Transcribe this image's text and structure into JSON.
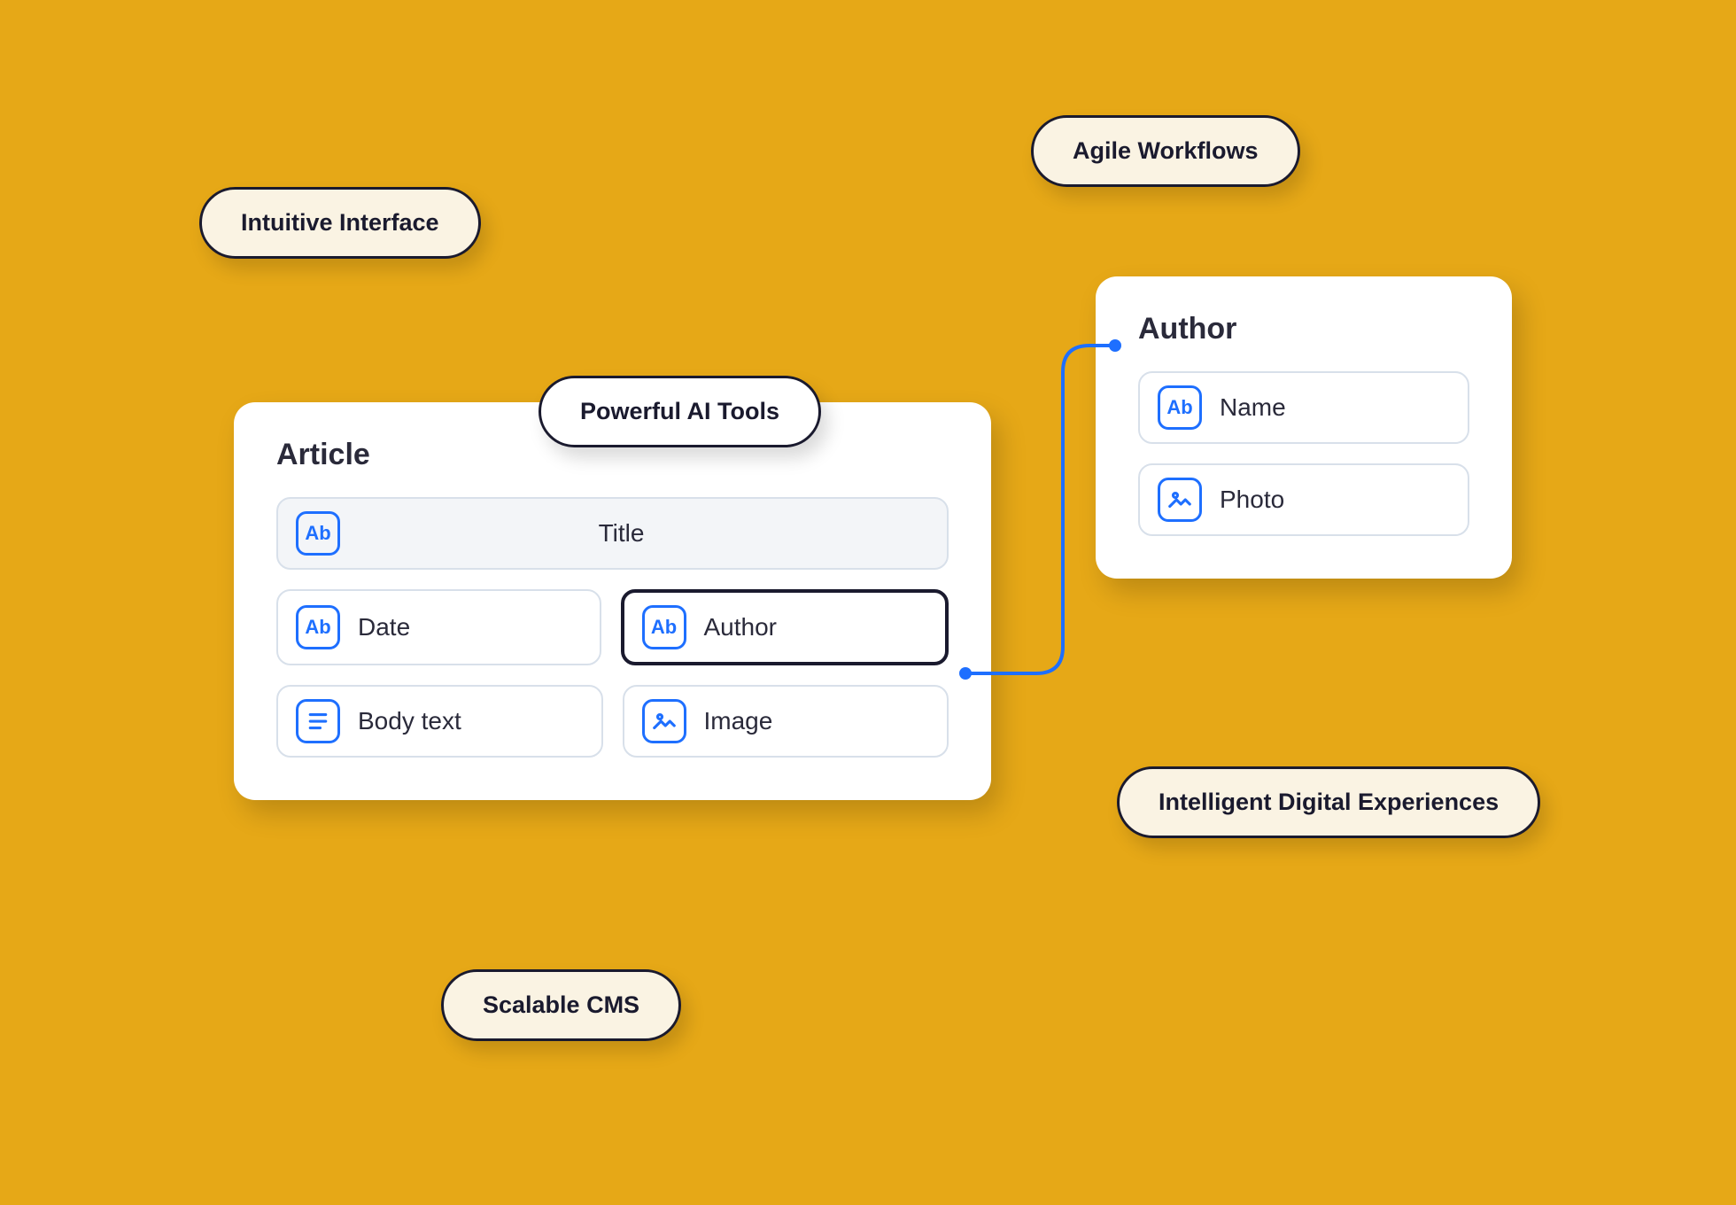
{
  "pills": {
    "intuitive": "Intuitive Interface",
    "agile": "Agile Workflows",
    "ai": "Powerful AI Tools",
    "digital": "Intelligent Digital Experiences",
    "scalable": "Scalable CMS"
  },
  "article_card": {
    "title": "Article",
    "fields": {
      "title": "Title",
      "date": "Date",
      "author": "Author",
      "body": "Body text",
      "image": "Image"
    }
  },
  "author_card": {
    "title": "Author",
    "fields": {
      "name": "Name",
      "photo": "Photo"
    }
  },
  "icons": {
    "text": "Ab"
  }
}
